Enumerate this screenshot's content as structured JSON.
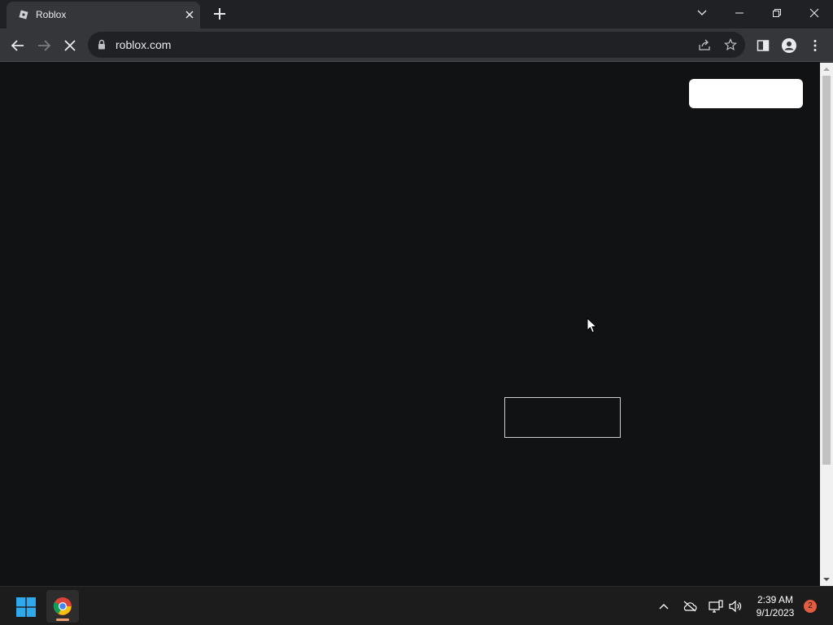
{
  "browser": {
    "tab": {
      "title": "Roblox"
    },
    "address": {
      "url": "roblox.com"
    }
  },
  "taskbar": {
    "time": "2:39 AM",
    "date": "9/1/2023",
    "notification_count": "2"
  },
  "colors": {
    "page_background": "#111213",
    "tabstrip": "#202124",
    "toolbar": "#35363a",
    "taskbar": "#1c1c1c",
    "notification_badge": "#e25c3f"
  }
}
